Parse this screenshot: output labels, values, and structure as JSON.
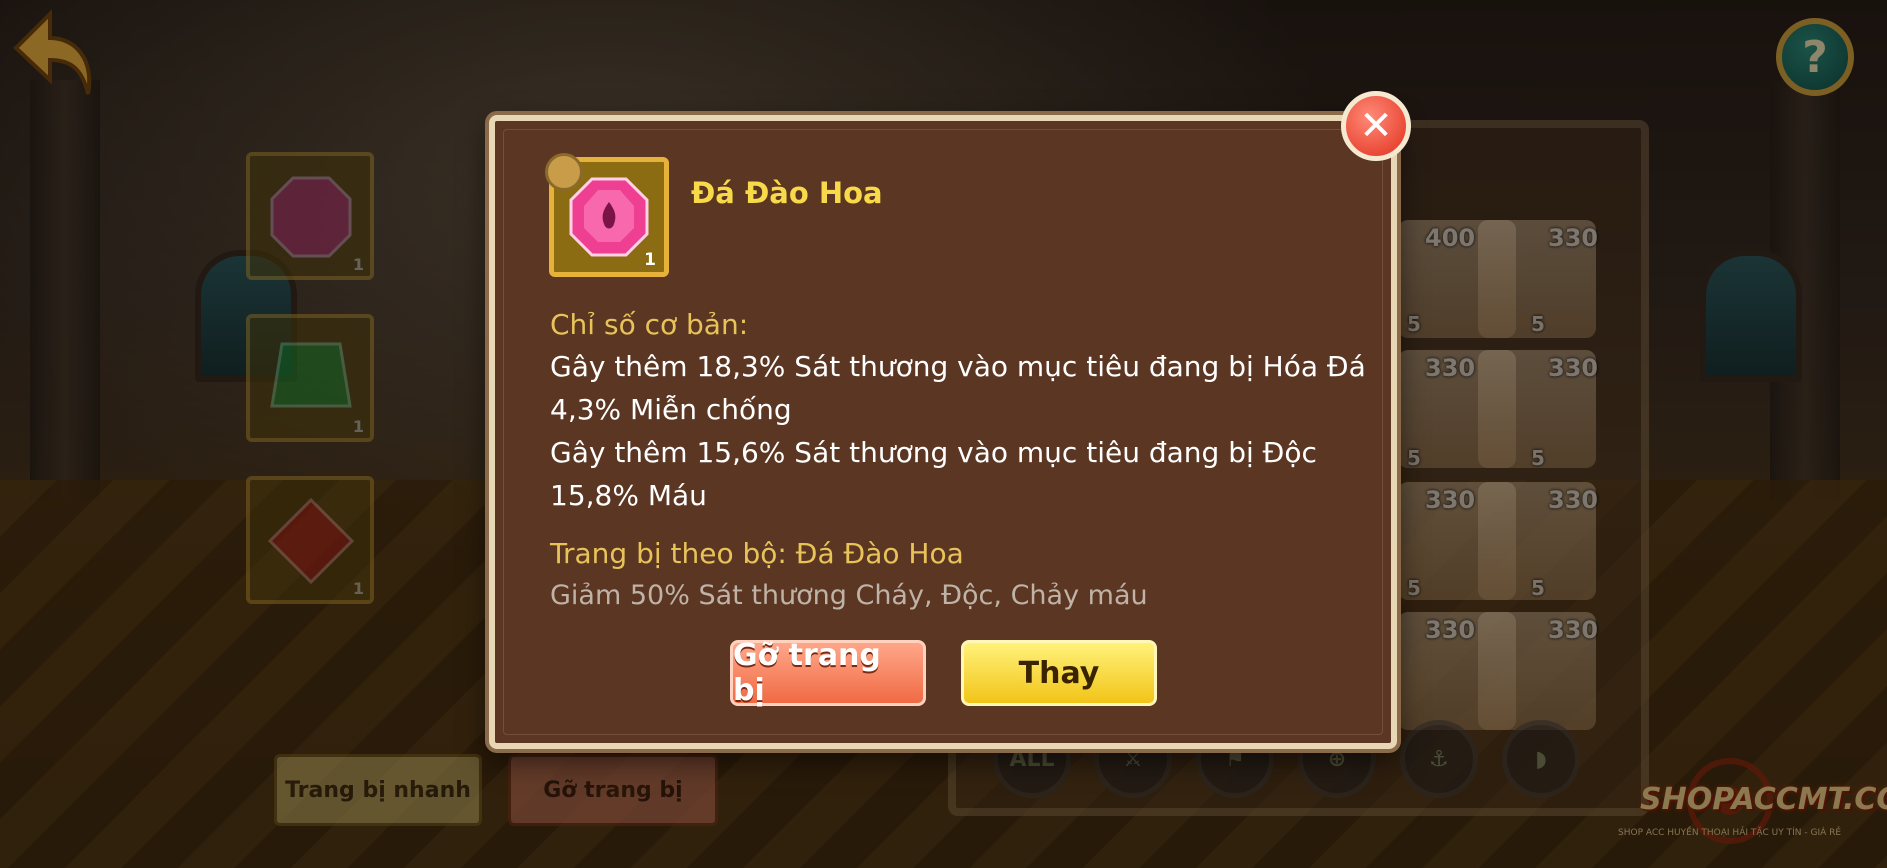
{
  "dialog": {
    "item": {
      "name": "Đá Đào Hoa",
      "count": "1"
    },
    "base_stats_heading": "Chỉ số cơ bản:",
    "stats": [
      "Gây thêm 18,3% Sát thương vào mục tiêu đang bị Hóa Đá",
      "4,3% Miễn chống",
      "Gây thêm 15,6% Sát thương vào mục tiêu đang bị Độc",
      "15,8% Máu"
    ],
    "set_heading": "Trang bị theo bộ: Đá Đào Hoa",
    "set_description": "Giảm 50% Sát thương Cháy, Độc, Chảy máu",
    "buttons": {
      "unequip": "Gỡ trang bị",
      "replace": "Thay"
    }
  },
  "background": {
    "slots": [
      {
        "gem": "pink-gem-icon",
        "count": "1"
      },
      {
        "gem": "green-gem-icon",
        "count": "1"
      },
      {
        "gem": "red-gem-icon",
        "count": "1"
      }
    ],
    "card_levels": [
      "400",
      "330",
      "330",
      "330",
      "330",
      "330",
      "330",
      "330"
    ],
    "card_stars": [
      "5",
      "5",
      "5",
      "5",
      "5",
      "5"
    ],
    "filter_all": "ALL",
    "quick_equip": "Trang bị nhanh",
    "unequip_all": "Gỡ trang bị"
  },
  "watermark": {
    "brand": "SHOPACCMT.COM",
    "tagline": "SHOP ACC HUYỀN THOẠI HẢI TẶC UY TÍN - GIÁ RẺ"
  },
  "colors": {
    "dialog_bg": "#5b3622",
    "title_yellow": "#f7d94a",
    "heading_gold": "#e7c35a",
    "unequip_orange": "#f06a44",
    "replace_yellow": "#f2c418",
    "close_red": "#e0301c"
  }
}
